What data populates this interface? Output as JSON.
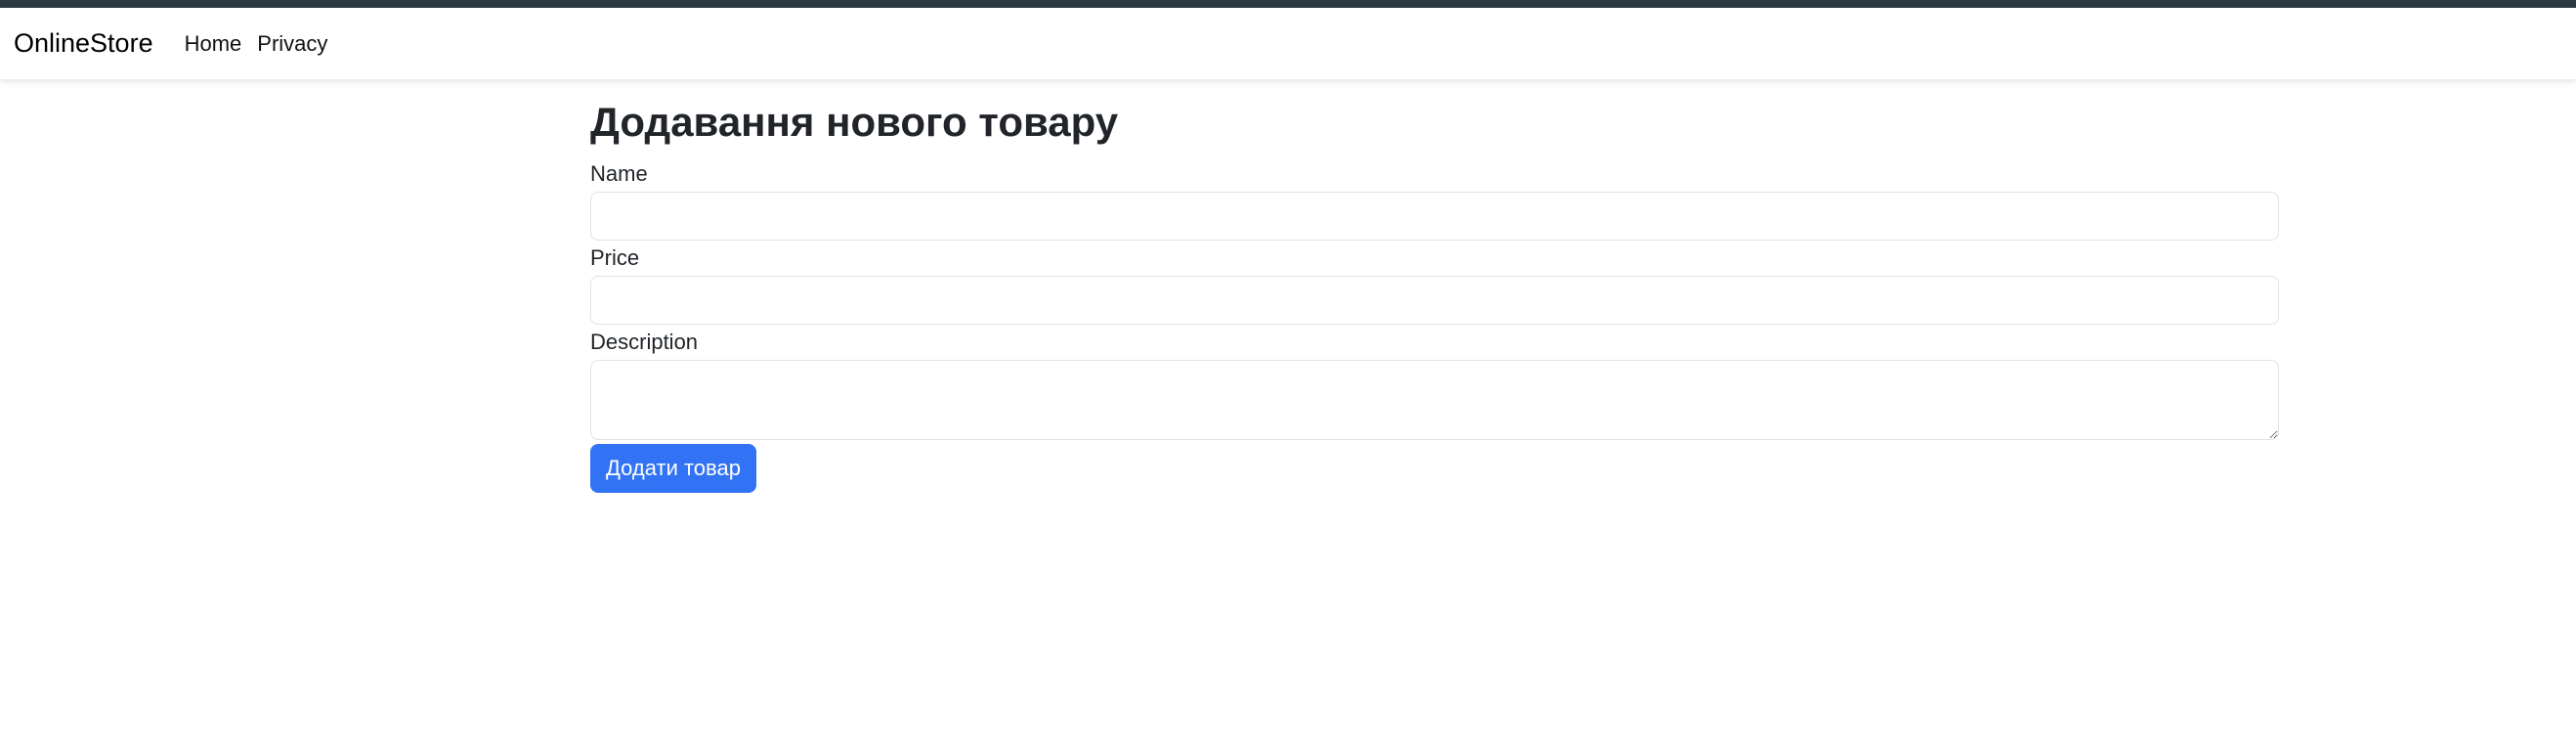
{
  "navbar": {
    "brand": "OnlineStore",
    "links": [
      {
        "label": "Home"
      },
      {
        "label": "Privacy"
      }
    ]
  },
  "main": {
    "title": "Додавання нового товару",
    "fields": {
      "name": {
        "label": "Name",
        "value": ""
      },
      "price": {
        "label": "Price",
        "value": ""
      },
      "description": {
        "label": "Description",
        "value": ""
      }
    },
    "submit_label": "Додати товар"
  },
  "colors": {
    "top_strip": "#2b3a3e",
    "primary_button": "#3273f5",
    "text": "#212529"
  }
}
